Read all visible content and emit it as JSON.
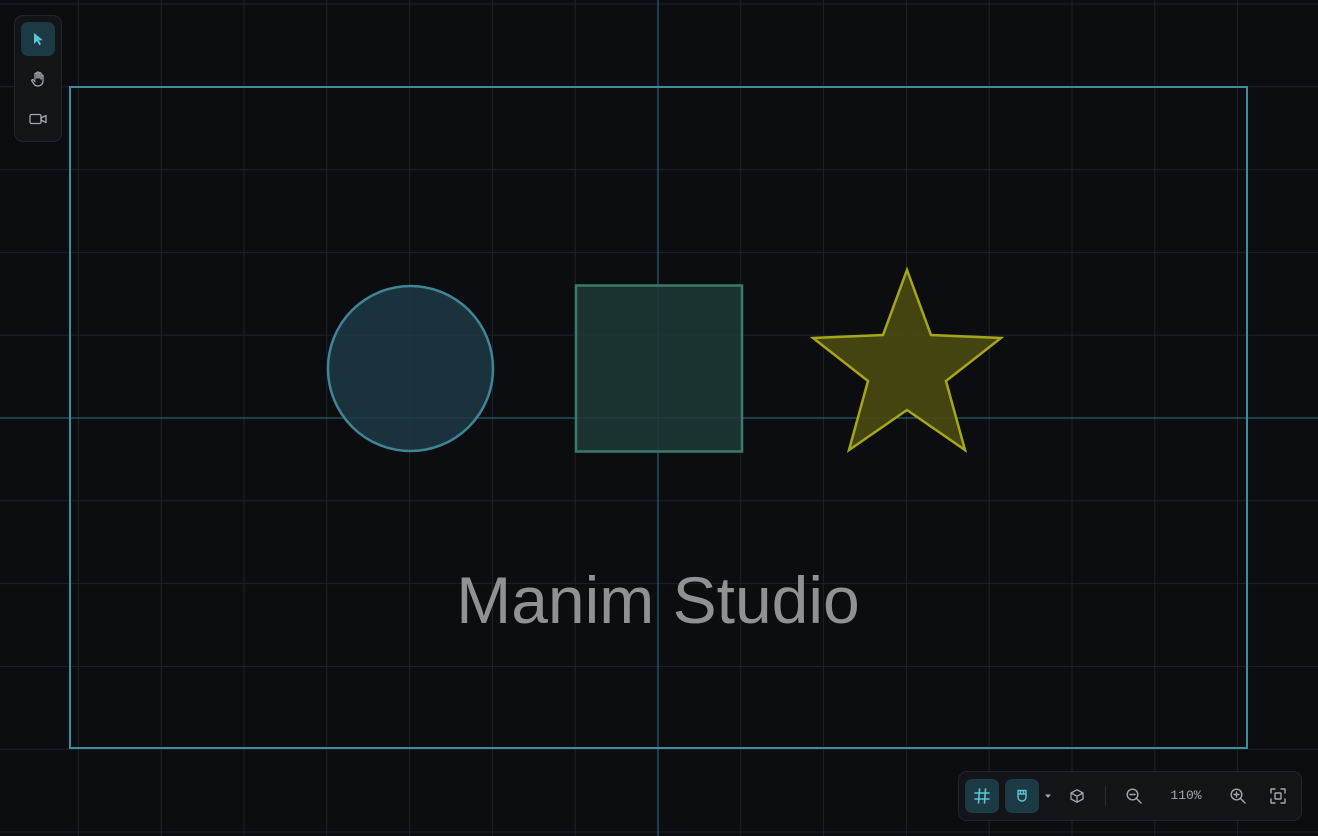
{
  "canvas": {
    "scene_title": "Manim Studio",
    "colors": {
      "background": "#0c0d10",
      "grid": "#1d2228",
      "axes": "#2f6f7f",
      "frame": "#3f8d9c",
      "circle_fill": "#1d3a44",
      "circle_stroke": "#3f8596",
      "square_fill": "#1d3a36",
      "square_stroke": "#3b7a68",
      "star_fill": "#4a4a12",
      "star_stroke": "#a6a61c",
      "text": "#8f9295"
    },
    "shapes": [
      "circle",
      "square",
      "star"
    ]
  },
  "tool_palette": {
    "tools": [
      {
        "id": "select",
        "icon": "cursor-icon",
        "active": true
      },
      {
        "id": "pan",
        "icon": "hand-icon",
        "active": false
      },
      {
        "id": "camera",
        "icon": "video-camera-icon",
        "active": false
      }
    ]
  },
  "view_toolbar": {
    "grid_toggle": {
      "icon": "grid-icon",
      "active": true
    },
    "snap_toggle": {
      "icon": "magnet-icon",
      "active": true
    },
    "snap_dropdown": {
      "icon": "caret-down-icon"
    },
    "view_3d": {
      "icon": "cube-icon"
    },
    "zoom_out": {
      "icon": "zoom-out-icon"
    },
    "zoom_level": "110%",
    "zoom_in": {
      "icon": "zoom-in-icon"
    },
    "fit_view": {
      "icon": "fit-screen-icon"
    }
  }
}
